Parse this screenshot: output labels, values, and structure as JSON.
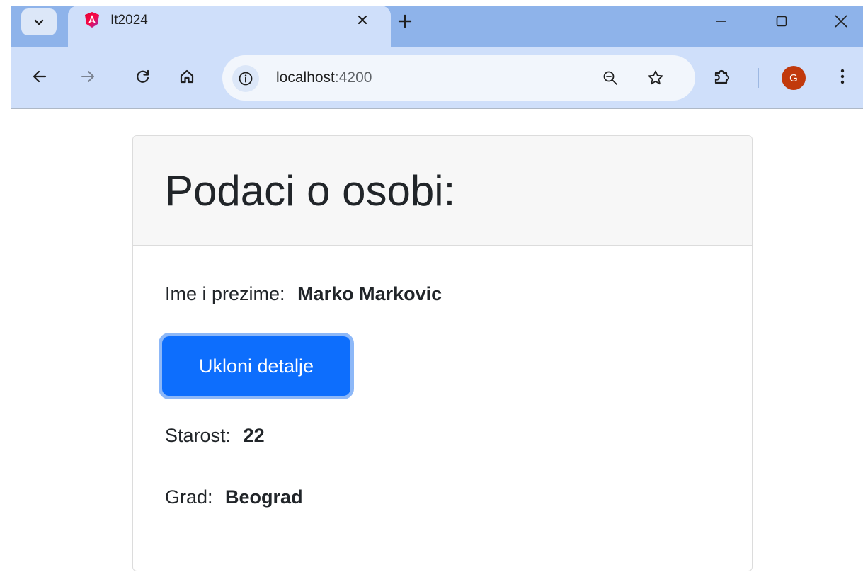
{
  "browser": {
    "tab_title": "It2024",
    "url_host": "localhost",
    "url_port": ":4200",
    "profile_initial": "G",
    "profile_color": "#c1390c"
  },
  "page": {
    "card_title": "Podaci o osobi:",
    "name_label": "Ime i prezime:",
    "name_value": "Marko Markovic",
    "button_label": "Ukloni detalje",
    "age_label": "Starost:",
    "age_value": "22",
    "city_label": "Grad:",
    "city_value": "Beograd"
  },
  "colors": {
    "button_primary": "#0d6efd",
    "tabstrip": "#8eb3ea",
    "toolbar": "#cfdffa"
  }
}
